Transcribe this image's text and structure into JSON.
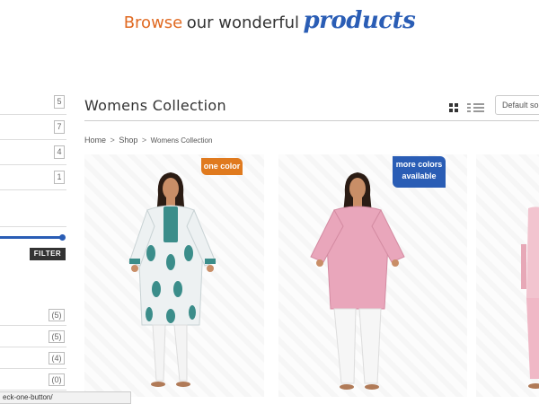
{
  "banner": {
    "word1": "Browse",
    "word2": "our wonderful",
    "word3": "products"
  },
  "sidebar": {
    "categories": [
      {
        "count": "5"
      },
      {
        "count": "7"
      },
      {
        "count": "4"
      },
      {
        "count": "1"
      }
    ],
    "price_filter": {
      "value_fraction": 1.0
    },
    "filter_label": "FILTER",
    "sizes": [
      {
        "count": "(5)"
      },
      {
        "count": "(5)"
      },
      {
        "count": "(4)"
      },
      {
        "count": "(0)"
      }
    ]
  },
  "main": {
    "title": "Womens Collection",
    "sort_placeholder": "Default sort",
    "breadcrumb": {
      "home": "Home",
      "shop": "Shop",
      "current": "Womens Collection",
      "sep": ">"
    },
    "products": [
      {
        "badge": "one color",
        "badge_color": "#e07a1e",
        "tunic_color": "#e9eef0",
        "tunic_pattern": "#3b8d8a",
        "pants_color": "#f2f2f2"
      },
      {
        "badge_line1": "more colors",
        "badge_line2": "available",
        "badge_color": "#2a5db5",
        "tunic_color": "#e9a6bb",
        "pants_color": "#f5f5f5"
      },
      {
        "tunic_color": "#f2c4cf",
        "pants_color": "#f0b8c6"
      }
    ]
  },
  "status_bar": {
    "url_text": "eck-one-button/"
  },
  "colors": {
    "accent_blue": "#2a5db5",
    "accent_orange": "#e06a22"
  }
}
